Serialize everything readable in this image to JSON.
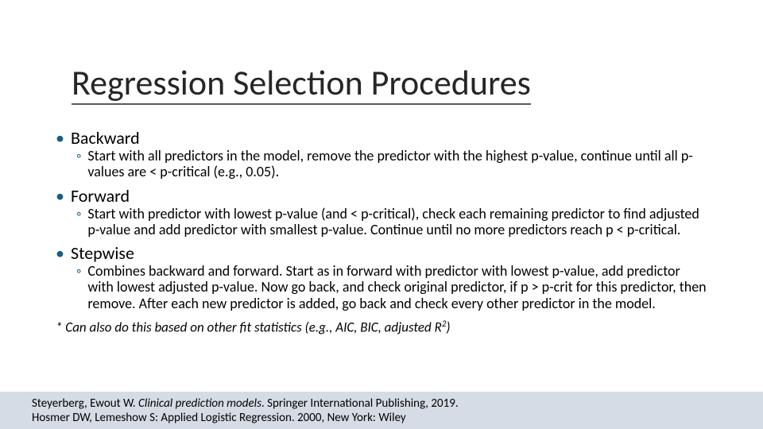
{
  "title": "Regression Selection Procedures",
  "bullets": {
    "b1": {
      "label": "Backward",
      "sub": "Start with all predictors in the model, remove the predictor with the highest p-value, continue until all p-values are < p-critical (e.g., 0.05)."
    },
    "b2": {
      "label": "Forward",
      "sub": "Start with predictor with lowest p-value (and < p-critical), check each remaining predictor to find adjusted p-value and add predictor with smallest p-value. Continue until no more predictors reach p < p-critical."
    },
    "b3": {
      "label": "Stepwise",
      "sub": "Combines backward and forward. Start as in forward with predictor with lowest p-value, add predictor with lowest adjusted p-value. Now go back, and check original predictor, if p > p-crit for this predictor, then remove. After each new predictor is added, go back and check every other predictor in the model."
    }
  },
  "footnote_prefix": "* Can also do this based on other fit statistics (e.g., AIC, BIC, adjusted R",
  "footnote_exp": "2",
  "footnote_suffix": ")",
  "refs": {
    "r1_author": "Steyerberg, Ewout W. ",
    "r1_title": "Clinical prediction models",
    "r1_rest": ". Springer International Publishing, 2019.",
    "r2": "Hosmer DW, Lemeshow S: Applied Logistic Regression. 2000, New York: Wiley"
  }
}
